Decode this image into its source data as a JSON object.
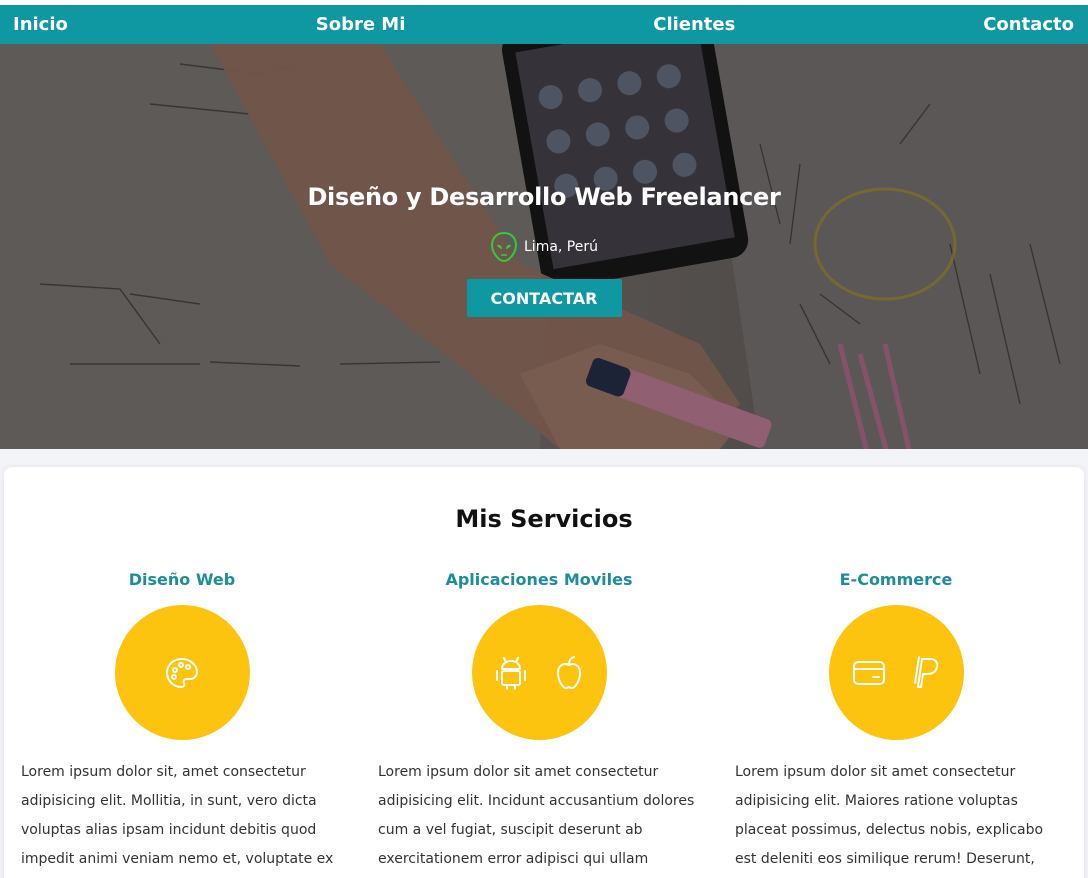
{
  "nav": {
    "items": [
      "Inicio",
      "Sobre Mi",
      "Clientes",
      "Contacto"
    ]
  },
  "hero": {
    "title": "Diseño y Desarrollo Web Freelancer",
    "location": "Lima, Perú",
    "button_label": "CONTACTAR"
  },
  "services": {
    "heading": "Mis Servicios",
    "items": [
      {
        "title": "Diseño Web",
        "icons": [
          "palette-icon"
        ],
        "text": "Lorem ipsum dolor sit, amet consectetur adipisicing elit. Mollitia, in sunt, vero dicta voluptas alias ipsam incidunt debitis quod impedit animi veniam nemo et, voluptate ex"
      },
      {
        "title": "Aplicaciones Moviles",
        "icons": [
          "android-icon",
          "apple-icon"
        ],
        "text": "Lorem ipsum dolor sit amet consectetur adipisicing elit. Incidunt accusantium dolores cum a vel fugiat, suscipit deserunt ab exercitationem error adipisci qui ullam debitis?"
      },
      {
        "title": "E-Commerce",
        "icons": [
          "credit-card-icon",
          "paypal-icon"
        ],
        "text": "Lorem ipsum dolor sit amet consectetur adipisicing elit. Maiores ratione voluptas placeat possimus, delectus nobis, explicabo est deleniti eos similique rerum! Deserunt, perspiciatis"
      }
    ]
  },
  "colors": {
    "primary": "#0f97a2",
    "accent": "#fcc30f",
    "service_title": "#1c8e9b",
    "alien_icon": "#2ecc40"
  }
}
